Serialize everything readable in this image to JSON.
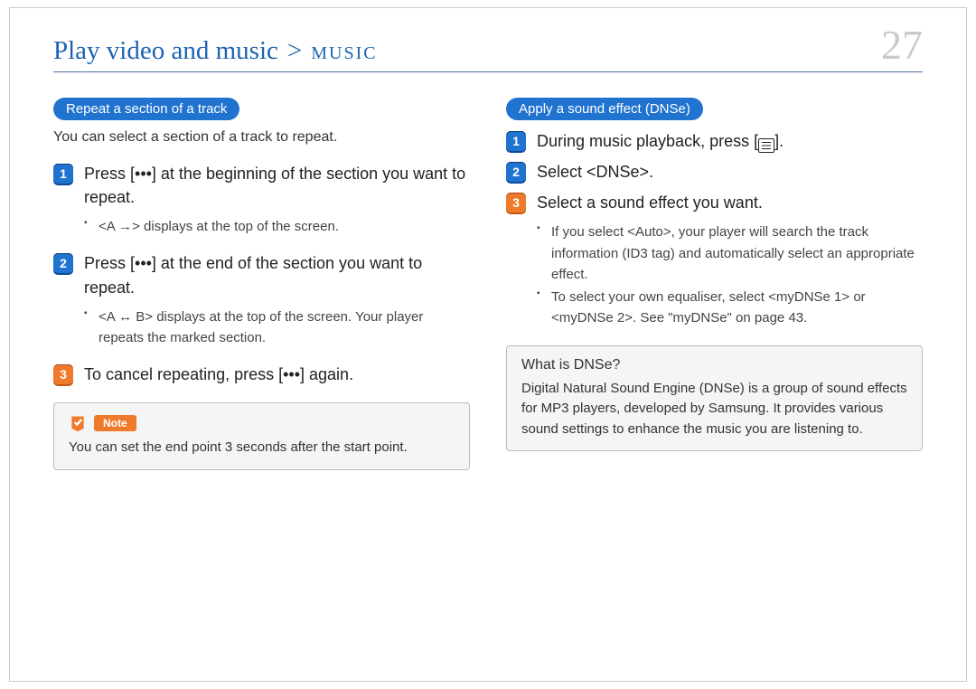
{
  "header": {
    "section": "Play video and music",
    "separator": ">",
    "subsection": "MUSIC",
    "page_number": "27"
  },
  "left": {
    "heading": "Repeat a section of a track",
    "intro": "You can select a section of a track to repeat.",
    "steps": [
      {
        "text": "Press [•••] at the beginning of the section you want to repeat.",
        "bullets": [
          "<A →> displays at the top of the screen."
        ]
      },
      {
        "text": "Press [•••] at the end of the section you want to repeat.",
        "bullets": [
          "<A ↔ B> displays at the top of the screen. Your player repeats the marked section."
        ]
      },
      {
        "text": "To cancel repeating, press [•••] again.",
        "bullets": []
      }
    ],
    "note": {
      "label": "Note",
      "text": "You can set the end point 3 seconds after the start point."
    }
  },
  "right": {
    "heading": "Apply a sound effect (DNSe)",
    "steps": [
      {
        "text_pre": "During music playback, press [",
        "text_post": "].",
        "has_icon": true,
        "bullets": []
      },
      {
        "text": "Select <DNSe>.",
        "bullets": []
      },
      {
        "text": "Select a sound effect you want.",
        "bullets": [
          "If you select <Auto>, your player will search the track information (ID3 tag) and automatically select an appropriate effect.",
          "To select your own equaliser, select <myDNSe 1> or <myDNSe 2>. See \"myDNSe\" on page 43."
        ]
      }
    ],
    "info": {
      "title": "What is DNSe?",
      "text": "Digital Natural Sound Engine (DNSe) is a group of sound effects for MP3 players, developed by Samsung. It provides various sound settings to enhance the music you are listening to."
    }
  }
}
